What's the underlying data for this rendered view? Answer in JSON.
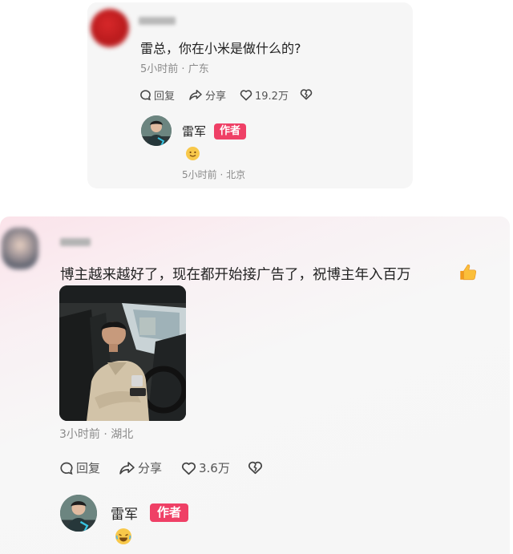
{
  "comment1": {
    "text": "雷总，你在小米是做什么的?",
    "time": "5小时前",
    "location": "广东",
    "actions": {
      "reply": "回复",
      "share": "分享",
      "likes": "19.2万"
    },
    "reply": {
      "name": "雷军",
      "badge": "作者",
      "time": "5小时前",
      "location": "北京"
    }
  },
  "comment2": {
    "text": "博主越来越好了，现在都开始接广告了，祝博主年入百万",
    "time": "3小时前",
    "location": "湖北",
    "actions": {
      "reply": "回复",
      "share": "分享",
      "likes": "3.6万"
    },
    "reply": {
      "name": "雷军",
      "badge": "作者"
    }
  },
  "separator": "·",
  "colors": {
    "author_badge": "#ef4066",
    "meta_text": "#8a8a8a",
    "card_bg": "#f6f6f6"
  },
  "icons": [
    "reply-icon",
    "share-icon",
    "heart-icon",
    "broken-heart-icon",
    "thumbs-up-emoji",
    "smile-emoji",
    "laugh-emoji"
  ]
}
